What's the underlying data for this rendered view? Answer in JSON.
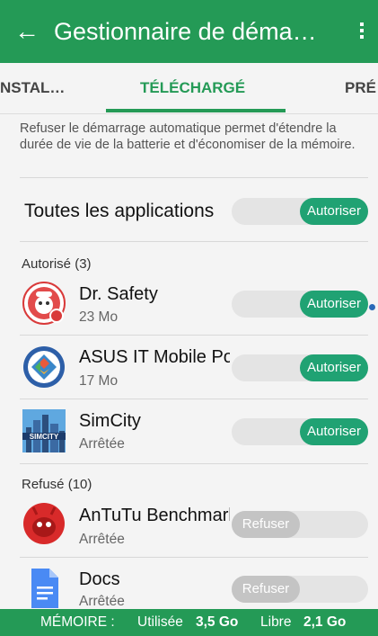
{
  "header": {
    "title": "Gestionnaire de déma…"
  },
  "tabs": [
    {
      "label": "NSTAL…"
    },
    {
      "label": "TÉLÉCHARGÉ"
    },
    {
      "label": "PRÉ"
    }
  ],
  "description": "Refuser le démarrage automatique permet d'étendre la durée de vie de la batterie et d'économiser de la mémoire.",
  "all_apps": {
    "label": "Toutes les applications",
    "toggle": "Autoriser"
  },
  "allowed": {
    "heading": "Autorisé (3)",
    "apps": [
      {
        "name": "Dr. Safety",
        "detail": "23 Mo",
        "toggle": "Autoriser"
      },
      {
        "name": "ASUS IT Mobile Portal",
        "detail": "17 Mo",
        "toggle": "Autoriser"
      },
      {
        "name": "SimCity",
        "detail": "Arrêtée",
        "toggle": "Autoriser"
      }
    ]
  },
  "refused": {
    "heading": "Refusé (10)",
    "apps": [
      {
        "name": "AnTuTu Benchmark",
        "detail": "Arrêtée",
        "toggle": "Refuser"
      },
      {
        "name": "Docs",
        "detail": "Arrêtée",
        "toggle": "Refuser"
      }
    ]
  },
  "footer": {
    "memory_label": "MÉMOIRE :",
    "used_label": "Utilisée",
    "used_value": "3,5 Go",
    "free_label": "Libre",
    "free_value": "2,1 Go"
  },
  "colors": {
    "primary": "#249a56",
    "toggle_on": "#20a273",
    "toggle_off": "#c4c4c4"
  }
}
